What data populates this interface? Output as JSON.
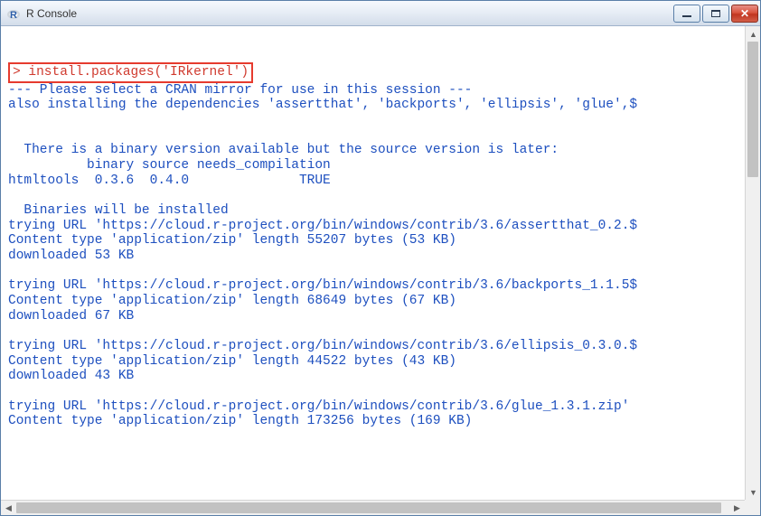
{
  "window": {
    "title": "R Console",
    "icon_letter": "R"
  },
  "command": {
    "prompt": "> ",
    "text": "install.packages('IRkernel')"
  },
  "output": [
    "--- Please select a CRAN mirror for use in this session ---",
    "also installing the dependencies 'assertthat', 'backports', 'ellipsis', 'glue',$",
    "",
    "",
    "  There is a binary version available but the source version is later:",
    "          binary source needs_compilation",
    "htmltools  0.3.6  0.4.0              TRUE",
    "",
    "  Binaries will be installed",
    "trying URL 'https://cloud.r-project.org/bin/windows/contrib/3.6/assertthat_0.2.$",
    "Content type 'application/zip' length 55207 bytes (53 KB)",
    "downloaded 53 KB",
    "",
    "trying URL 'https://cloud.r-project.org/bin/windows/contrib/3.6/backports_1.1.5$",
    "Content type 'application/zip' length 68649 bytes (67 KB)",
    "downloaded 67 KB",
    "",
    "trying URL 'https://cloud.r-project.org/bin/windows/contrib/3.6/ellipsis_0.3.0.$",
    "Content type 'application/zip' length 44522 bytes (43 KB)",
    "downloaded 43 KB",
    "",
    "trying URL 'https://cloud.r-project.org/bin/windows/contrib/3.6/glue_1.3.1.zip'",
    "Content type 'application/zip' length 173256 bytes (169 KB)"
  ]
}
